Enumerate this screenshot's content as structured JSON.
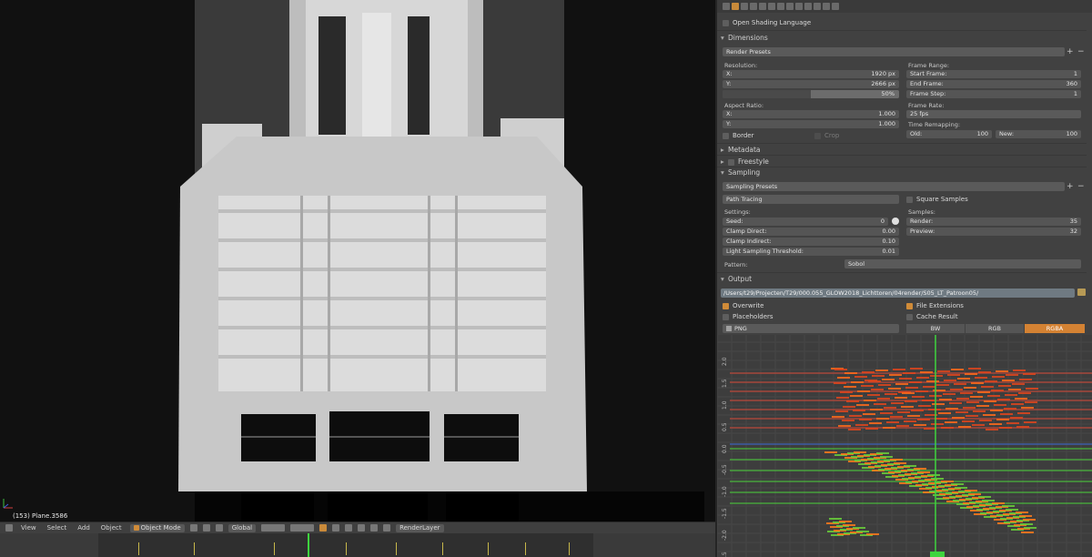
{
  "viewport": {
    "object_info": "(153) Plane.3586"
  },
  "view3d_header": {
    "menus": [
      "View",
      "Select",
      "Add",
      "Object"
    ],
    "mode": "Object Mode",
    "orientation": "Global",
    "render_layer": "RenderLayer"
  },
  "properties": {
    "osl_label": "Open Shading Language",
    "dimensions": {
      "title": "Dimensions",
      "render_presets": "Render Presets",
      "resolution_label": "Resolution:",
      "res_x_label": "X:",
      "res_x": "1920 px",
      "res_y_label": "Y:",
      "res_y": "2666 px",
      "res_pct": "50%",
      "aspect_label": "Aspect Ratio:",
      "aspect_x_label": "X:",
      "aspect_x": "1.000",
      "aspect_y_label": "Y:",
      "aspect_y": "1.000",
      "border": "Border",
      "crop": "Crop",
      "frame_range_label": "Frame Range:",
      "start_label": "Start Frame:",
      "start": "1",
      "end_label": "End Frame:",
      "end": "360",
      "step_label": "Frame Step:",
      "step": "1",
      "frame_rate_label": "Frame Rate:",
      "frame_rate": "25 fps",
      "remap_label": "Time Remapping:",
      "old_label": "Old:",
      "old": "100",
      "new_label": "New:",
      "new": "100"
    },
    "metadata": {
      "title": "Metadata"
    },
    "freestyle": {
      "title": "Freestyle"
    },
    "sampling": {
      "title": "Sampling",
      "presets": "Sampling Presets",
      "integrator": "Path Tracing",
      "square_samples": "Square Samples",
      "settings_label": "Settings:",
      "seed_label": "Seed:",
      "seed": "0",
      "clamp_direct_label": "Clamp Direct:",
      "clamp_direct": "0.00",
      "clamp_indirect_label": "Clamp Indirect:",
      "clamp_indirect": "0.10",
      "lst_label": "Light Sampling Threshold:",
      "lst": "0.01",
      "samples_label": "Samples:",
      "render_label": "Render:",
      "render": "35",
      "preview_label": "Preview:",
      "preview": "32",
      "pattern_label": "Pattern:",
      "pattern": "Sobol"
    },
    "output": {
      "title": "Output",
      "path": "/Users/t29/Projecten/T29/000.055_GLOW2018_Lichttoren/04render/S05_LT_Patroon05/",
      "overwrite": "Overwrite",
      "file_extensions": "File Extensions",
      "placeholders": "Placeholders",
      "cache_result": "Cache Result",
      "format": "PNG",
      "color_modes": [
        "BW",
        "RGB",
        "RGBA"
      ],
      "color_mode_active": "RGBA"
    }
  },
  "graph_editor": {
    "y_ticks": [
      "2.0",
      "1.5",
      "1.0",
      "0.5",
      "0.0",
      "-0.5",
      "-1.0",
      "-1.5",
      "-2.0",
      "-2.5"
    ]
  },
  "colors": {
    "accent": "#d48233",
    "playhead": "#3ed43e"
  }
}
